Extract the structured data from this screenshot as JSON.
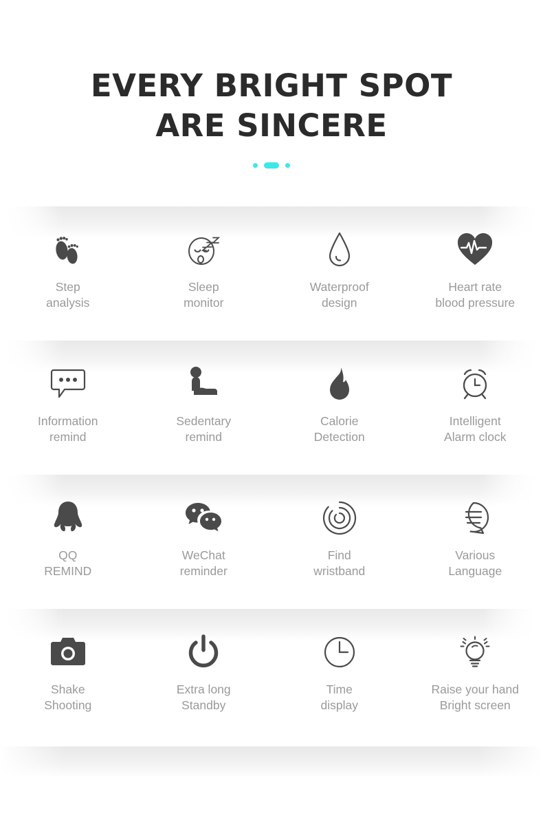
{
  "header": {
    "title_line1": "EVERY BRIGHT SPOT",
    "title_line2": "ARE SINCERE",
    "accent_color": "#3de8e8"
  },
  "colors": {
    "title": "#2b2b2b",
    "label": "#9a9a9a",
    "icon": "#4a4a4a",
    "band": "#e7e7e8",
    "background": "#ffffff"
  },
  "features": {
    "rows": [
      {
        "tiles": [
          {
            "icon": "footprints-icon",
            "label": "Step\nanalysis"
          },
          {
            "icon": "sleeping-face-icon",
            "label": "Sleep\nmonitor"
          },
          {
            "icon": "water-drop-icon",
            "label": "Waterproof\ndesign"
          },
          {
            "icon": "heart-pulse-icon",
            "label": "Heart rate\nblood pressure"
          }
        ]
      },
      {
        "tiles": [
          {
            "icon": "speech-bubble-dots-icon",
            "label": "Information\nremind"
          },
          {
            "icon": "seated-person-icon",
            "label": "Sedentary\nremind"
          },
          {
            "icon": "flame-icon",
            "label": "Calorie\nDetection"
          },
          {
            "icon": "alarm-clock-icon",
            "label": "Intelligent\nAlarm clock"
          }
        ]
      },
      {
        "tiles": [
          {
            "icon": "qq-penguin-icon",
            "label": "QQ\nREMIND"
          },
          {
            "icon": "wechat-bubbles-icon",
            "label": "WeChat\nreminder"
          },
          {
            "icon": "locate-target-icon",
            "label": "Find\nwristband"
          },
          {
            "icon": "language-bubble-icon",
            "label": "Various\nLanguage"
          }
        ]
      },
      {
        "tiles": [
          {
            "icon": "camera-icon",
            "label": "Shake\nShooting"
          },
          {
            "icon": "power-icon",
            "label": "Extra long\nStandby"
          },
          {
            "icon": "clock-icon",
            "label": "Time\ndisplay"
          },
          {
            "icon": "lightbulb-icon",
            "label": "Raise your hand\nBright screen"
          }
        ]
      }
    ]
  }
}
